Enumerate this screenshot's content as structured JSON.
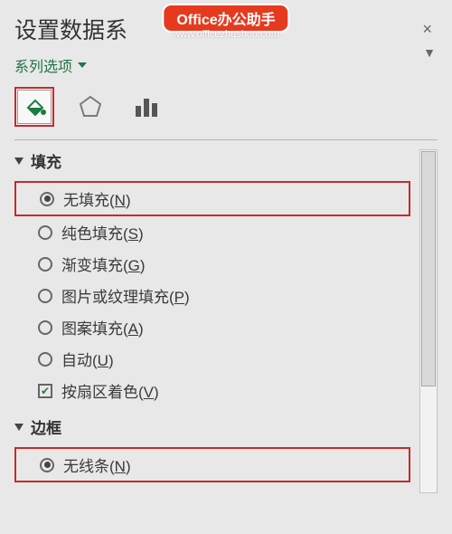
{
  "watermark": {
    "title": "Office办公助手",
    "url": "www.officezhushou.com"
  },
  "pane": {
    "title_prefix": "设置数据系",
    "series_dropdown": "系列选项",
    "close_symbol": "×"
  },
  "sections": {
    "fill": {
      "label": "填充",
      "options": {
        "none": {
          "text": "无填充",
          "key": "N",
          "checked": true
        },
        "solid": {
          "text": "纯色填充",
          "key": "S",
          "checked": false
        },
        "gradient": {
          "text": "渐变填充",
          "key": "G",
          "checked": false
        },
        "picture": {
          "text": "图片或纹理填充",
          "key": "P",
          "checked": false
        },
        "pattern": {
          "text": "图案填充",
          "key": "A",
          "checked": false
        },
        "auto": {
          "text": "自动",
          "key": "U",
          "checked": false
        }
      },
      "vary_colors": {
        "text": "按扇区着色",
        "key": "V",
        "checked": true
      }
    },
    "border": {
      "label": "边框",
      "options": {
        "none": {
          "text": "无线条",
          "key": "N",
          "checked": true
        }
      }
    }
  }
}
